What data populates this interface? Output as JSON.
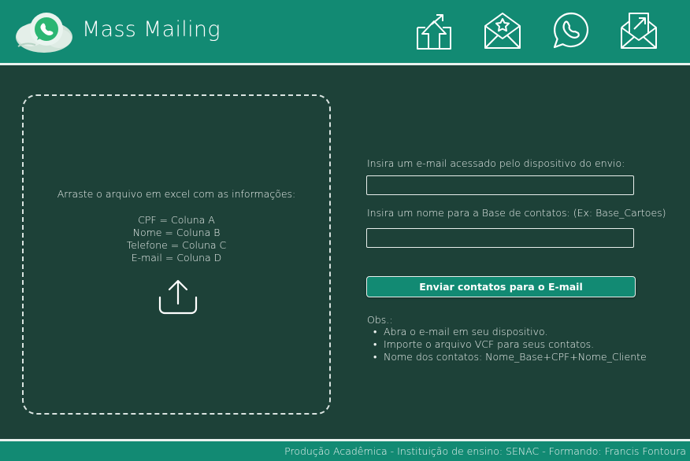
{
  "header": {
    "title": "Mass Mailing",
    "icons": [
      "upload-box-icon",
      "starred-mail-icon",
      "whatsapp-icon",
      "send-mail-icon"
    ]
  },
  "dropzone": {
    "instruction": "Arraste o arquivo em excel com as informações:",
    "mapping": [
      "CPF = Coluna A",
      "Nome = Coluna B",
      "Telefone = Coluna C",
      "E-mail = Coluna D"
    ],
    "icon": "upload-icon"
  },
  "form": {
    "email_label": "Insira um e-mail acessado pelo dispositivo do envio:",
    "email_value": "",
    "base_label": "Insira um nome para a Base de contatos:  (Ex: Base_Cartoes)",
    "base_value": "",
    "send_button": "Enviar contatos para o E-mail"
  },
  "notes": {
    "heading": "Obs.:",
    "items": [
      "Abra o e-mail em seu dispositivo.",
      "Importe o arquivo VCF para seus contatos.",
      "Nome dos contatos: Nome_Base+CPF+Nome_Cliente"
    ]
  },
  "footer": {
    "text": "Produção Acadêmica - Instituição de ensino: SENAC - Formando: Francis Fontoura"
  },
  "colors": {
    "background": "#1d4138",
    "accent": "#128a73",
    "line": "#e9f2ef"
  }
}
